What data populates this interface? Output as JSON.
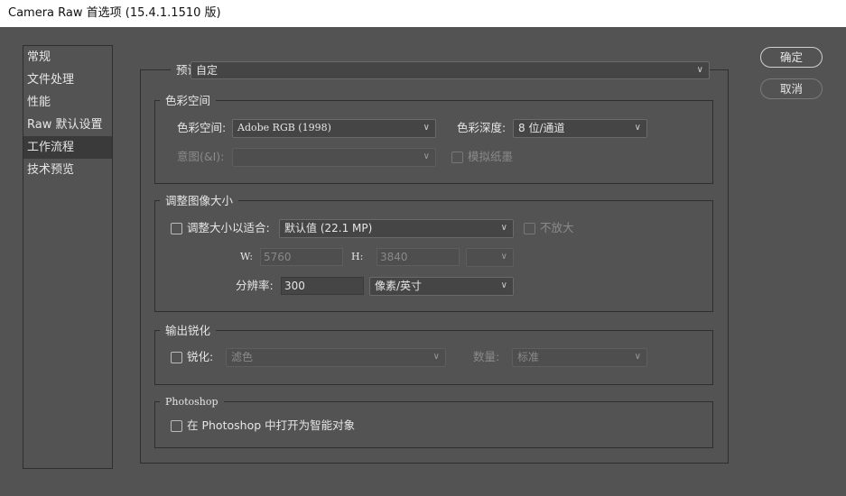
{
  "window": {
    "title": "Camera Raw 首选项 (15.4.1.1510 版)"
  },
  "sidebar": {
    "items": [
      {
        "label": "常规"
      },
      {
        "label": "文件处理"
      },
      {
        "label": "性能"
      },
      {
        "label": "Raw 默认设置"
      },
      {
        "label": "工作流程",
        "selected": true
      },
      {
        "label": "技术预览"
      }
    ]
  },
  "buttons": {
    "ok": "确定",
    "cancel": "取消"
  },
  "preset": {
    "label": "预设:",
    "value": "自定"
  },
  "color_space": {
    "title": "色彩空间",
    "space_label": "色彩空间:",
    "space_value": "Adobe RGB (1998)",
    "depth_label": "色彩深度:",
    "depth_value": "8 位/通道",
    "intent_label": "意图(&I):",
    "intent_value": "",
    "simulate_paper_label": "模拟纸墨"
  },
  "resize": {
    "title": "调整图像大小",
    "fit_label": "调整大小以适合:",
    "fit_value": "默认值 (22.1 MP)",
    "no_enlarge_label": "不放大",
    "w_label": "W:",
    "w_value": "5760",
    "h_label": "H:",
    "h_value": "3840",
    "unit_value": "",
    "resolution_label": "分辨率:",
    "resolution_value": "300",
    "resolution_unit": "像素/英寸"
  },
  "sharpen": {
    "title": "输出锐化",
    "sharpen_label": "锐化:",
    "sharpen_value": "滤色",
    "amount_label": "数量:",
    "amount_value": "标准"
  },
  "photoshop": {
    "title": "Photoshop",
    "smart_object_label": "在 Photoshop 中打开为智能对象"
  }
}
